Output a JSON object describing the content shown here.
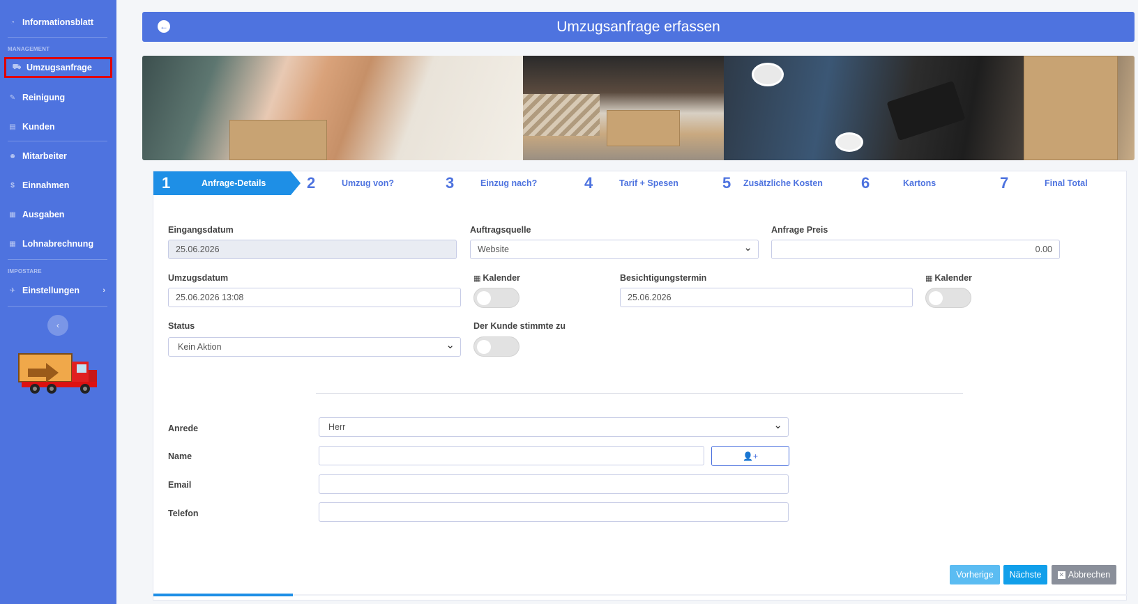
{
  "sidebar": {
    "dashboard_label": "Informationsblatt",
    "heading_management": "MANAGEMENT",
    "items": [
      {
        "label": "Umzugsanfrage"
      },
      {
        "label": "Reinigung"
      },
      {
        "label": "Kunden"
      },
      {
        "label": "Mitarbeiter"
      },
      {
        "label": "Einnahmen"
      },
      {
        "label": "Ausgaben"
      },
      {
        "label": "Lohnabrechnung"
      }
    ],
    "heading_settings": "IMPOSTARE",
    "settings_label": "Einstellungen",
    "collapse_icon": "chevron-left-icon",
    "colors": {
      "background": "#4e73df",
      "active_outline": "#e00000"
    }
  },
  "header": {
    "title": "Umzugsanfrage erfassen"
  },
  "steps": [
    {
      "num": "1",
      "label": "Anfrage-Details"
    },
    {
      "num": "2",
      "label": "Umzug von?"
    },
    {
      "num": "3",
      "label": "Einzug nach?"
    },
    {
      "num": "4",
      "label": "Tarif + Spesen"
    },
    {
      "num": "5",
      "label": "Zusätzliche Kosten"
    },
    {
      "num": "6",
      "label": "Kartons"
    },
    {
      "num": "7",
      "label": "Final Total"
    }
  ],
  "form": {
    "eingangsdatum": {
      "label": "Eingangsdatum",
      "value": "25.06.2026"
    },
    "auftragsquelle": {
      "label": "Auftragsquelle",
      "value": "Website"
    },
    "anfrage_preis": {
      "label": "Anfrage Preis",
      "value": "0.00"
    },
    "umzugsdatum": {
      "label": "Umzugsdatum",
      "value": "25.06.2026 13:08"
    },
    "kalender_label": "Kalender",
    "besichtigung": {
      "label": "Besichtigungstermin",
      "value": "25.06.2026"
    },
    "status": {
      "label": "Status",
      "value": "Kein Aktion"
    },
    "kunde_zustimmung": {
      "label": "Der Kunde stimmte zu"
    },
    "anrede": {
      "label": "Anrede",
      "value": "Herr"
    },
    "name": {
      "label": "Name",
      "value": ""
    },
    "email": {
      "label": "Email",
      "value": ""
    },
    "telefon": {
      "label": "Telefon",
      "value": ""
    }
  },
  "actions": {
    "prev": "Vorherige",
    "next": "Nächste",
    "cancel": "Abbrechen"
  },
  "progress": {
    "fraction": 0.143
  }
}
